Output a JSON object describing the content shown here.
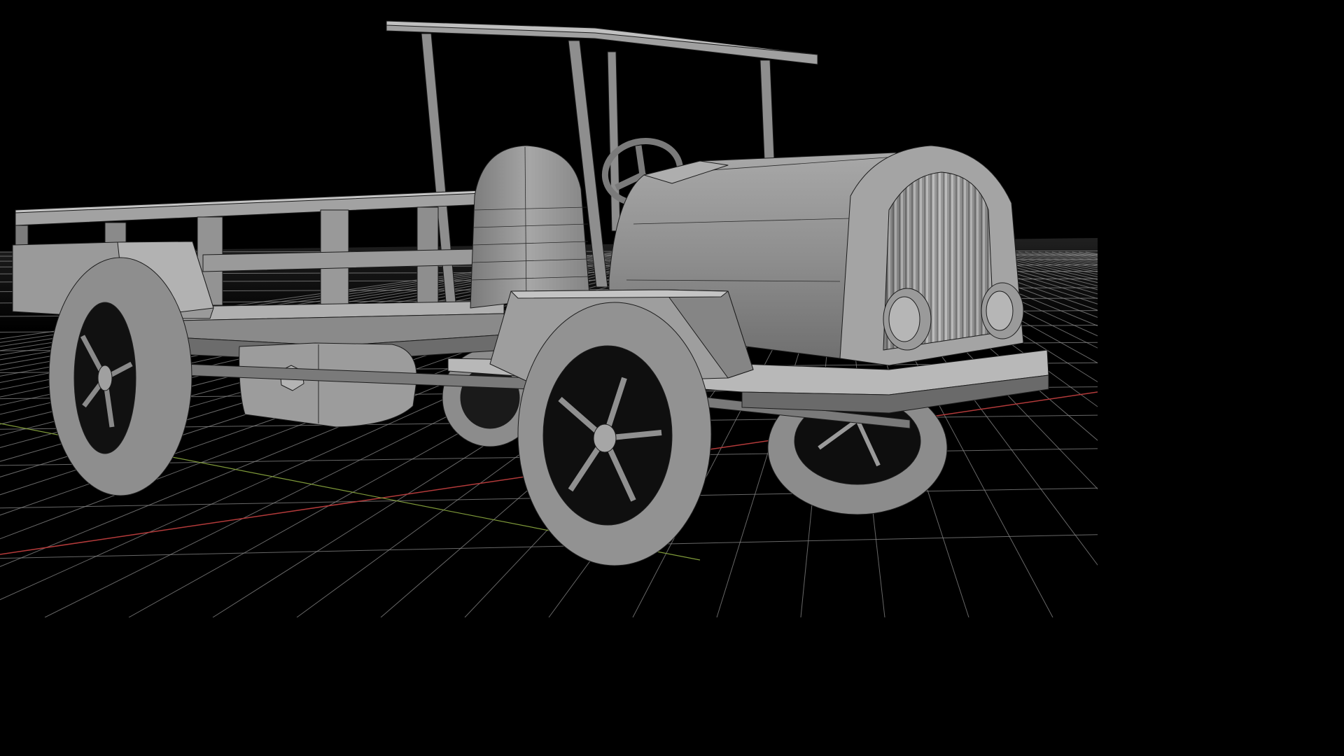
{
  "viewport": {
    "background": "#000000",
    "grid_color": "#8a8a8a",
    "x_axis_color": "#b33a3a",
    "y_axis_color": "#7f9a3a",
    "mesh_fill": "#8c8c8c",
    "mesh_light": "#b4b4b4",
    "mesh_dark": "#5a5a5a",
    "wire_color": "#1c1c1c"
  },
  "scene": {
    "object": "truck-mesh",
    "shading": "solid",
    "overlays": [
      "wireframe",
      "floor-grid",
      "axis-lines"
    ]
  }
}
